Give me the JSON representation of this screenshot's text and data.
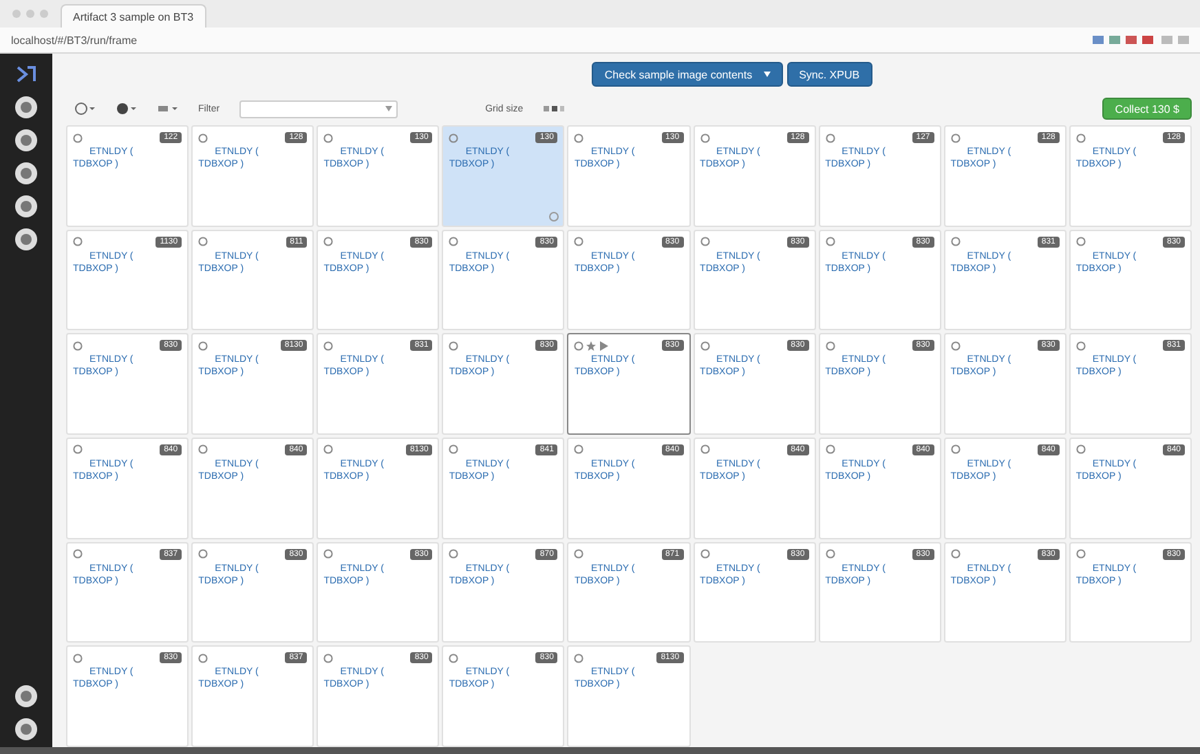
{
  "browser": {
    "tab_title": "Artifact 3 sample on BT3",
    "address": "localhost/#/BT3/run/frame"
  },
  "actions": {
    "primary": "Check sample image contents",
    "secondary": "Sync. XPUB",
    "collect": "Collect 130 $"
  },
  "toolbar": {
    "filter_label": "Filter",
    "grid_label": "Grid size"
  },
  "tiles": [
    {
      "badge": "122",
      "title": "ETNLDY (",
      "subtitle": "TDBXOP )",
      "selected": false,
      "hovered": false
    },
    {
      "badge": "128",
      "title": "ETNLDY (",
      "subtitle": "TDBXOP )",
      "selected": false,
      "hovered": false
    },
    {
      "badge": "130",
      "title": "ETNLDY (",
      "subtitle": "TDBXOP )",
      "selected": false,
      "hovered": false
    },
    {
      "badge": "130",
      "title": "ETNLDY (",
      "subtitle": "TDBXOP )",
      "selected": true,
      "hovered": false
    },
    {
      "badge": "130",
      "title": "ETNLDY (",
      "subtitle": "TDBXOP )",
      "selected": false,
      "hovered": false
    },
    {
      "badge": "128",
      "title": "ETNLDY (",
      "subtitle": "TDBXOP )",
      "selected": false,
      "hovered": false
    },
    {
      "badge": "127",
      "title": "ETNLDY (",
      "subtitle": "TDBXOP )",
      "selected": false,
      "hovered": false
    },
    {
      "badge": "128",
      "title": "ETNLDY (",
      "subtitle": "TDBXOP )",
      "selected": false,
      "hovered": false
    },
    {
      "badge": "128",
      "title": "ETNLDY (",
      "subtitle": "TDBXOP )",
      "selected": false,
      "hovered": false
    },
    {
      "badge": "1130",
      "title": "ETNLDY (",
      "subtitle": "TDBXOP )",
      "selected": false,
      "hovered": false
    },
    {
      "badge": "811",
      "title": "ETNLDY (",
      "subtitle": "TDBXOP )",
      "selected": false,
      "hovered": false
    },
    {
      "badge": "830",
      "title": "ETNLDY (",
      "subtitle": "TDBXOP )",
      "selected": false,
      "hovered": false
    },
    {
      "badge": "830",
      "title": "ETNLDY (",
      "subtitle": "TDBXOP )",
      "selected": false,
      "hovered": false
    },
    {
      "badge": "830",
      "title": "ETNLDY (",
      "subtitle": "TDBXOP )",
      "selected": false,
      "hovered": false
    },
    {
      "badge": "830",
      "title": "ETNLDY (",
      "subtitle": "TDBXOP )",
      "selected": false,
      "hovered": false
    },
    {
      "badge": "830",
      "title": "ETNLDY (",
      "subtitle": "TDBXOP )",
      "selected": false,
      "hovered": false
    },
    {
      "badge": "831",
      "title": "ETNLDY (",
      "subtitle": "TDBXOP )",
      "selected": false,
      "hovered": false
    },
    {
      "badge": "830",
      "title": "ETNLDY (",
      "subtitle": "TDBXOP )",
      "selected": false,
      "hovered": false
    },
    {
      "badge": "830",
      "title": "ETNLDY (",
      "subtitle": "TDBXOP )",
      "selected": false,
      "hovered": false
    },
    {
      "badge": "8130",
      "title": "ETNLDY (",
      "subtitle": "TDBXOP )",
      "selected": false,
      "hovered": false
    },
    {
      "badge": "831",
      "title": "ETNLDY (",
      "subtitle": "TDBXOP )",
      "selected": false,
      "hovered": false
    },
    {
      "badge": "830",
      "title": "ETNLDY (",
      "subtitle": "TDBXOP )",
      "selected": false,
      "hovered": false
    },
    {
      "badge": "830",
      "title": "ETNLDY (",
      "subtitle": "TDBXOP )",
      "selected": false,
      "hovered": true
    },
    {
      "badge": "830",
      "title": "ETNLDY (",
      "subtitle": "TDBXOP )",
      "selected": false,
      "hovered": false
    },
    {
      "badge": "830",
      "title": "ETNLDY (",
      "subtitle": "TDBXOP )",
      "selected": false,
      "hovered": false
    },
    {
      "badge": "830",
      "title": "ETNLDY (",
      "subtitle": "TDBXOP )",
      "selected": false,
      "hovered": false
    },
    {
      "badge": "831",
      "title": "ETNLDY (",
      "subtitle": "TDBXOP )",
      "selected": false,
      "hovered": false
    },
    {
      "badge": "840",
      "title": "ETNLDY (",
      "subtitle": "TDBXOP )",
      "selected": false,
      "hovered": false
    },
    {
      "badge": "840",
      "title": "ETNLDY (",
      "subtitle": "TDBXOP )",
      "selected": false,
      "hovered": false
    },
    {
      "badge": "8130",
      "title": "ETNLDY (",
      "subtitle": "TDBXOP )",
      "selected": false,
      "hovered": false
    },
    {
      "badge": "841",
      "title": "ETNLDY (",
      "subtitle": "TDBXOP )",
      "selected": false,
      "hovered": false
    },
    {
      "badge": "840",
      "title": "ETNLDY (",
      "subtitle": "TDBXOP )",
      "selected": false,
      "hovered": false
    },
    {
      "badge": "840",
      "title": "ETNLDY (",
      "subtitle": "TDBXOP )",
      "selected": false,
      "hovered": false
    },
    {
      "badge": "840",
      "title": "ETNLDY (",
      "subtitle": "TDBXOP )",
      "selected": false,
      "hovered": false
    },
    {
      "badge": "840",
      "title": "ETNLDY (",
      "subtitle": "TDBXOP )",
      "selected": false,
      "hovered": false
    },
    {
      "badge": "840",
      "title": "ETNLDY (",
      "subtitle": "TDBXOP )",
      "selected": false,
      "hovered": false
    },
    {
      "badge": "837",
      "title": "ETNLDY (",
      "subtitle": "TDBXOP )",
      "selected": false,
      "hovered": false
    },
    {
      "badge": "830",
      "title": "ETNLDY (",
      "subtitle": "TDBXOP )",
      "selected": false,
      "hovered": false
    },
    {
      "badge": "830",
      "title": "ETNLDY (",
      "subtitle": "TDBXOP )",
      "selected": false,
      "hovered": false
    },
    {
      "badge": "870",
      "title": "ETNLDY (",
      "subtitle": "TDBXOP )",
      "selected": false,
      "hovered": false
    },
    {
      "badge": "871",
      "title": "ETNLDY (",
      "subtitle": "TDBXOP )",
      "selected": false,
      "hovered": false
    },
    {
      "badge": "830",
      "title": "ETNLDY (",
      "subtitle": "TDBXOP )",
      "selected": false,
      "hovered": false
    },
    {
      "badge": "830",
      "title": "ETNLDY (",
      "subtitle": "TDBXOP )",
      "selected": false,
      "hovered": false
    },
    {
      "badge": "830",
      "title": "ETNLDY (",
      "subtitle": "TDBXOP )",
      "selected": false,
      "hovered": false
    },
    {
      "badge": "830",
      "title": "ETNLDY (",
      "subtitle": "TDBXOP )",
      "selected": false,
      "hovered": false
    },
    {
      "badge": "830",
      "title": "ETNLDY (",
      "subtitle": "TDBXOP )",
      "selected": false,
      "hovered": false
    },
    {
      "badge": "837",
      "title": "ETNLDY (",
      "subtitle": "TDBXOP )",
      "selected": false,
      "hovered": false
    },
    {
      "badge": "830",
      "title": "ETNLDY (",
      "subtitle": "TDBXOP )",
      "selected": false,
      "hovered": false
    },
    {
      "badge": "830",
      "title": "ETNLDY (",
      "subtitle": "TDBXOP )",
      "selected": false,
      "hovered": false
    },
    {
      "badge": "8130",
      "title": "ETNLDY (",
      "subtitle": "TDBXOP )",
      "selected": false,
      "hovered": false
    }
  ]
}
